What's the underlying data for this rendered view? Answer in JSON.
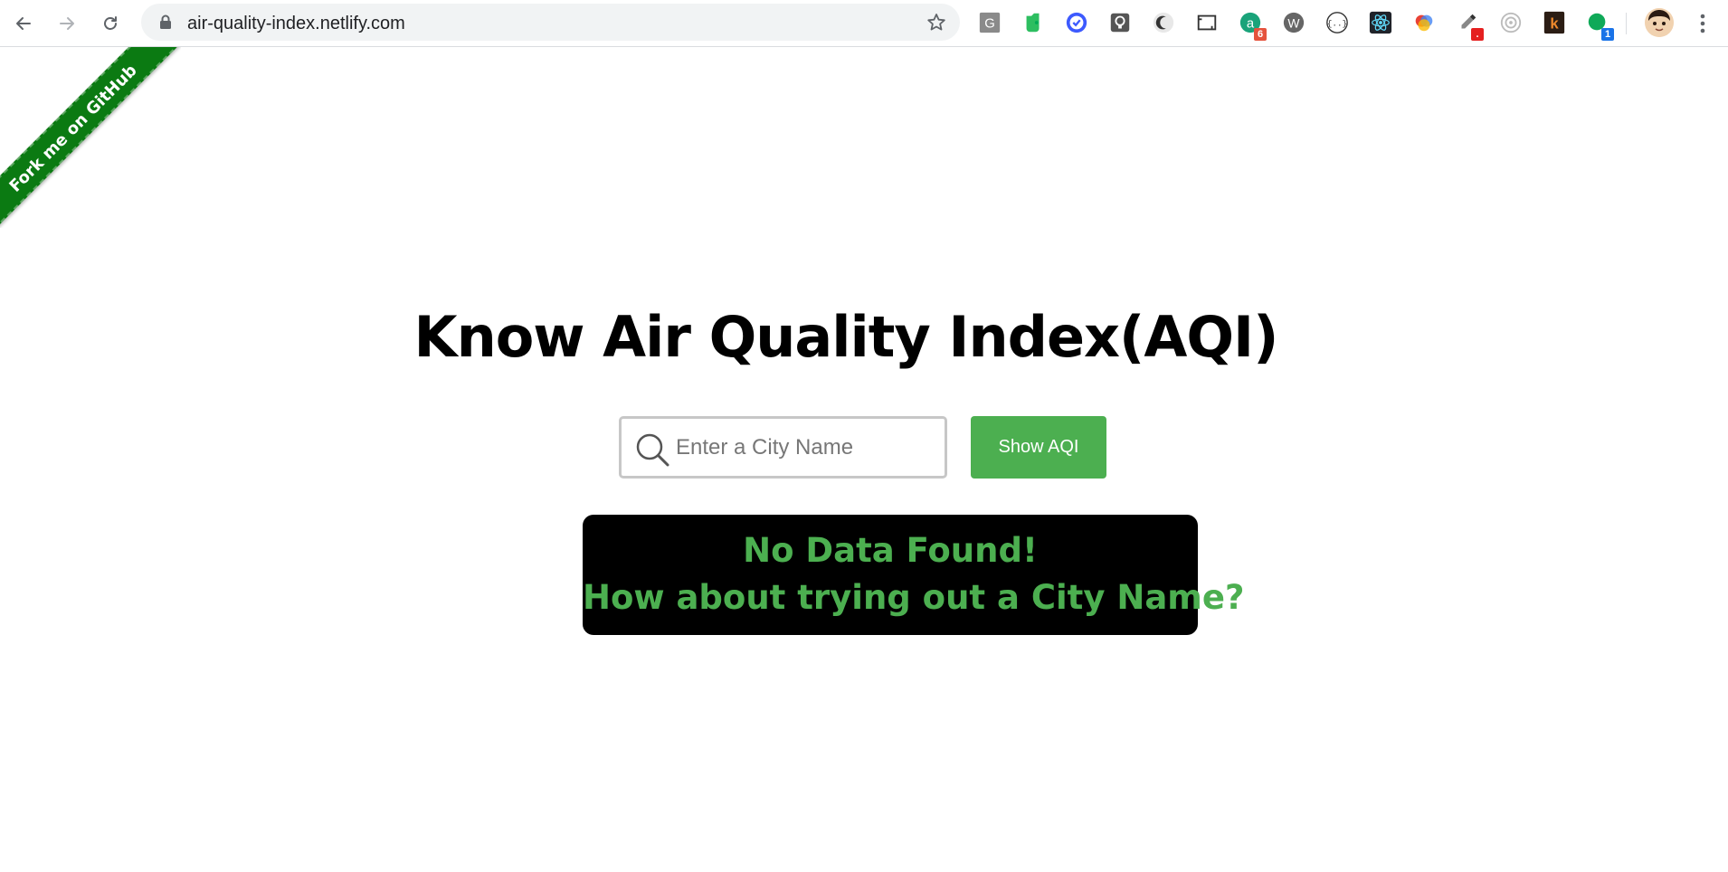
{
  "browser": {
    "url": "air-quality-index.netlify.com",
    "extensions": [
      {
        "icon": "grammarly-g-icon",
        "label": "G"
      },
      {
        "icon": "evernote-icon"
      },
      {
        "icon": "todo-check-icon"
      },
      {
        "icon": "lightbulb-icon"
      },
      {
        "icon": "dark-mode-moon-icon"
      },
      {
        "icon": "screenshot-icon"
      },
      {
        "icon": "a-extension-icon",
        "label": "a",
        "badge": "6"
      },
      {
        "icon": "wappalyzer-icon",
        "label": "W"
      },
      {
        "icon": "json-viewer-icon",
        "label": "{...}"
      },
      {
        "icon": "react-devtools-icon"
      },
      {
        "icon": "color-palette-icon"
      },
      {
        "icon": "eyedropper-icon",
        "badge": "."
      },
      {
        "icon": "target-icon"
      },
      {
        "icon": "k-extension-icon",
        "label": "k"
      },
      {
        "icon": "green-circle-icon",
        "badge": "1"
      }
    ]
  },
  "ribbon": {
    "label": "Fork me on GitHub"
  },
  "page": {
    "title": "Know Air Quality Index(AQI)",
    "search_placeholder": "Enter a City Name",
    "search_value": "",
    "button_label": "Show AQI",
    "result_line1": "No Data Found!",
    "result_line2": "How about trying out a City Name?"
  },
  "colors": {
    "accent_green": "#4caf50",
    "ribbon_green": "#0b7a12",
    "result_bg": "#000000"
  }
}
